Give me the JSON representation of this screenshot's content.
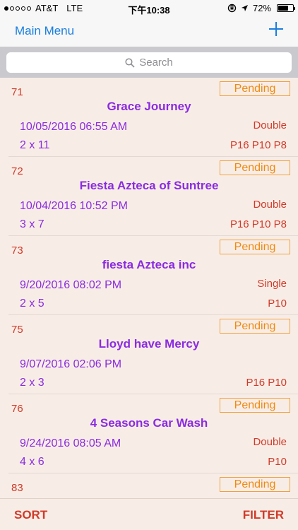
{
  "status": {
    "carrier": "AT&T",
    "network": "LTE",
    "time": "下午10:38",
    "battery": "72%",
    "battery_level": 0.72,
    "signal_bars": 1
  },
  "nav": {
    "back_label": "Main Menu"
  },
  "search": {
    "placeholder": "Search"
  },
  "orders": [
    {
      "num": "71",
      "status": "Pending",
      "name": "Grace Journey",
      "datetime": "10/05/2016 06:55 AM",
      "type": "Double",
      "size": "2 x 11",
      "codes": "P16 P10 P8"
    },
    {
      "num": "72",
      "status": "Pending",
      "name": "Fiesta Azteca of Suntree",
      "datetime": "10/04/2016 10:52 PM",
      "type": "Double",
      "size": "3 x 7",
      "codes": "P16 P10 P8"
    },
    {
      "num": "73",
      "status": "Pending",
      "name": "fiesta Azteca inc",
      "datetime": "9/20/2016 08:02 PM",
      "type": "Single",
      "size": "2 x 5",
      "codes": "P10"
    },
    {
      "num": "75",
      "status": "Pending",
      "name": "Lloyd have Mercy",
      "datetime": "9/07/2016 02:06 PM",
      "type": "",
      "size": "2 x 3",
      "codes": "P16 P10"
    },
    {
      "num": "76",
      "status": "Pending",
      "name": "4 Seasons Car Wash",
      "datetime": "9/24/2016 08:05 AM",
      "type": "Double",
      "size": "4 x 6",
      "codes": "P10"
    },
    {
      "num": "83",
      "status": "Pending",
      "name": "",
      "datetime": "",
      "type": "",
      "size": "",
      "codes": ""
    }
  ],
  "toolbar": {
    "sort_label": "SORT",
    "filter_label": "FILTER"
  }
}
